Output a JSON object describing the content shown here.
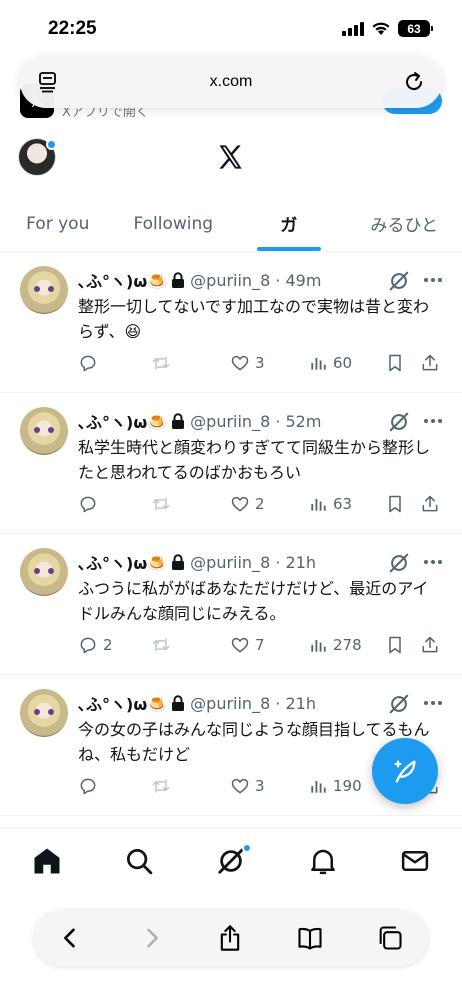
{
  "status_bar": {
    "time": "22:25",
    "battery": "63"
  },
  "browser": {
    "url": "x.com",
    "banner_text": "Xアプリで開く"
  },
  "tabs": [
    {
      "label": "For you",
      "active": false
    },
    {
      "label": "Following",
      "active": false
    },
    {
      "label": "ガ",
      "active": true
    },
    {
      "label": "みるひと",
      "active": false
    }
  ],
  "tweets": [
    {
      "name": "､ふ°ヽ)ω🍮",
      "handle": "@puriin_8 · 49m",
      "text": "整形一切してないです加工なので実物は昔と変わらず、😆",
      "replies": "",
      "likes": "3",
      "views": "60"
    },
    {
      "name": "､ふ°ヽ)ω🍮",
      "handle": "@puriin_8 · 52m",
      "text": "私学生時代と顔変わりすぎてて同級生から整形したと思われてるのばかおもろい",
      "replies": "",
      "likes": "2",
      "views": "63"
    },
    {
      "name": "､ふ°ヽ)ω🍮",
      "handle": "@puriin_8 · 21h",
      "text": "ふつうに私ががばあなただけだけど、最近のアイドルみんな顔同じにみえる。",
      "replies": "2",
      "likes": "7",
      "views": "278"
    },
    {
      "name": "､ふ°ヽ)ω🍮",
      "handle": "@puriin_8 · 21h",
      "text": "今の女の子はみんな同じような顔目指してるもんね、私もだけど",
      "replies": "",
      "likes": "3",
      "views": "190"
    }
  ],
  "colors": {
    "accent": "#1d9bf0",
    "text": "#0f1419",
    "muted": "#536471"
  },
  "icons": {
    "nav": [
      "home-icon",
      "search-icon",
      "grok-icon",
      "notifications-icon",
      "messages-icon"
    ],
    "safari": [
      "back-icon",
      "forward-icon",
      "share-icon",
      "bookmarks-icon",
      "tabs-icon"
    ]
  }
}
